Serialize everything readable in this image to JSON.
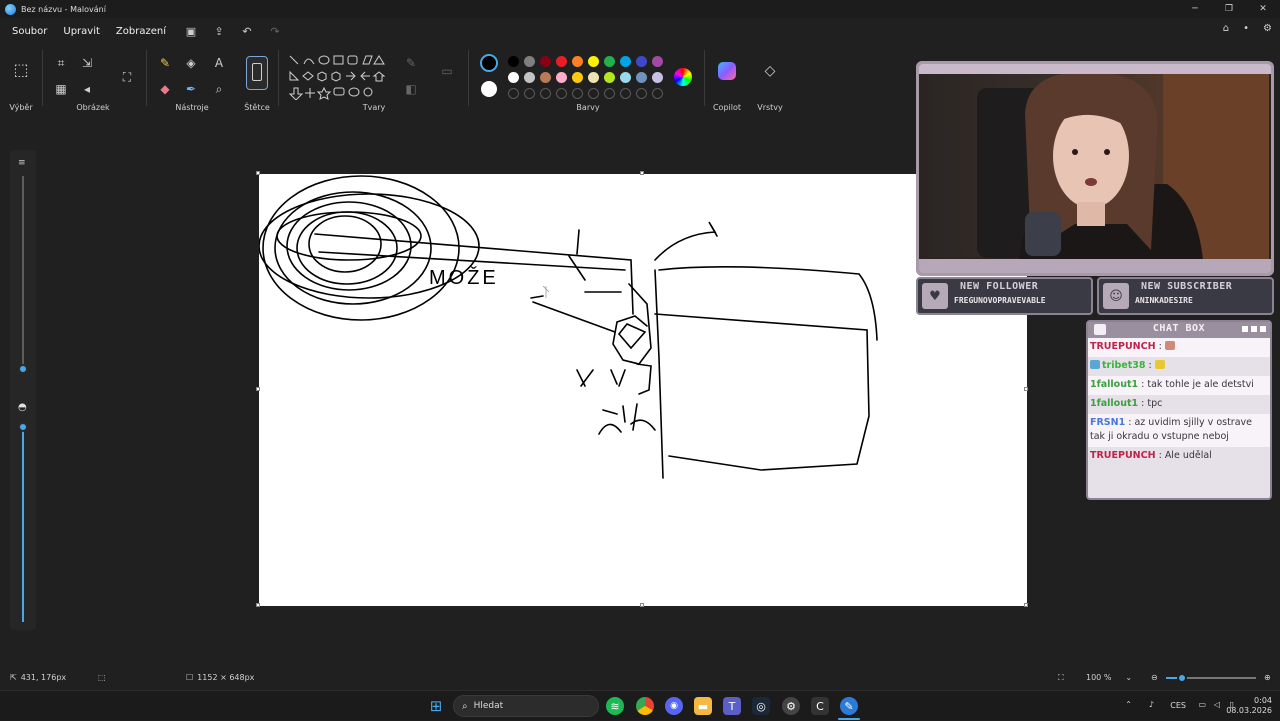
{
  "window": {
    "title": "Bez názvu - Malování"
  },
  "menu": {
    "items": [
      "Soubor",
      "Upravit",
      "Zobrazení"
    ]
  },
  "ribbon": {
    "groups": {
      "selection": "Výběr",
      "image": "Obrázek",
      "tools": "Nástroje",
      "brushes": "Štětce",
      "shapes": "Tvary",
      "colors": "Barvy",
      "copilot": "Copilot",
      "layers": "Vrstvy"
    },
    "palette_row1": [
      "#000000",
      "#7f7f7f",
      "#880015",
      "#ed1c24",
      "#ff7f27",
      "#fff200",
      "#22b14c",
      "#00a2e8",
      "#3f48cc",
      "#a349a4"
    ],
    "palette_row2": [
      "#ffffff",
      "#c3c3c3",
      "#b97a57",
      "#ffaec9",
      "#ffc90e",
      "#efe4b0",
      "#b5e61d",
      "#99d9ea",
      "#7092be",
      "#c8bfe7"
    ]
  },
  "stream": {
    "alerts": [
      {
        "title": "NEW FOLLOWER",
        "name": "FREGUNOVOPRAVEVABLE",
        "icon": "heart-icon"
      },
      {
        "title": "NEW SUBSCRIBER",
        "name": "ANINKADESIRE",
        "icon": "person-icon"
      }
    ],
    "chat": {
      "title": "CHAT BOX",
      "messages": [
        {
          "user": "TRUEPUNCH",
          "text": "",
          "user_color": "#c0234a",
          "emote": true
        },
        {
          "user": "tribet38",
          "text": "",
          "user_color": "#3ab43a",
          "emote": true
        },
        {
          "user": "1fallout1",
          "text": "tak tohle je ale detstvi",
          "user_color": "#3aa040"
        },
        {
          "user": "1fallout1",
          "text": "tpc",
          "user_color": "#3aa040"
        },
        {
          "user": "FRSN1",
          "text": "az uvidim sjilly v ostrave tak ji okradu o vstupne neboj",
          "user_color": "#4a78d6"
        },
        {
          "user": "TRUEPUNCH",
          "text": "Ale udělal",
          "user_color": "#c0234a"
        }
      ]
    }
  },
  "status": {
    "cursor_pos": "431, 176px",
    "canvas_size": "1152 × 648px",
    "zoom": "100 %",
    "zoom_fraction": 0.18
  },
  "taskbar": {
    "search_placeholder": "Hledat",
    "language": "CES",
    "time": "0:04",
    "date": "08.03.2026"
  },
  "canvas_drawing": {
    "text": "MOŽE"
  }
}
